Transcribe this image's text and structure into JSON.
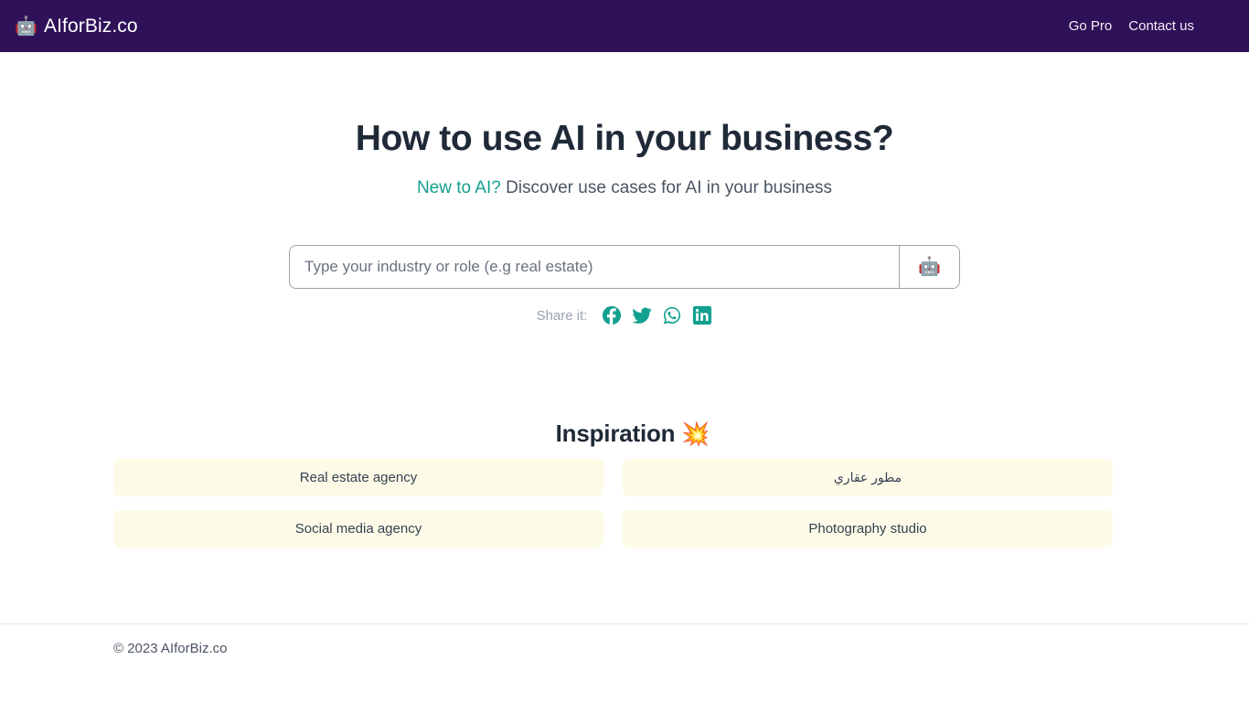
{
  "navbar": {
    "brand_icon": "robot-icon",
    "brand_icon_glyph": "🤖",
    "brand_name": "AIforBiz.co",
    "links": [
      {
        "label": "Go Pro"
      },
      {
        "label": "Contact us"
      }
    ]
  },
  "hero": {
    "title": "How to use AI in your business?",
    "subtitle_accent": "New to AI?",
    "subtitle_rest": " Discover use cases for AI in your business"
  },
  "search": {
    "placeholder": "Type your industry or role (e.g real estate)",
    "value": "",
    "submit_icon": "robot-icon",
    "submit_glyph": "🤖"
  },
  "share": {
    "label": "Share it:",
    "items": [
      {
        "name": "facebook-icon",
        "title": "Facebook"
      },
      {
        "name": "twitter-icon",
        "title": "Twitter"
      },
      {
        "name": "whatsapp-icon",
        "title": "WhatsApp"
      },
      {
        "name": "linkedin-icon",
        "title": "LinkedIn"
      }
    ]
  },
  "inspiration": {
    "heading": "Inspiration",
    "emoji": "💥",
    "cards": [
      {
        "label": "Real estate agency",
        "rtl": false
      },
      {
        "label": "مطور عقاري",
        "rtl": true
      },
      {
        "label": "Social media agency",
        "rtl": false
      },
      {
        "label": "Photography studio",
        "rtl": false
      }
    ]
  },
  "footer": {
    "copyright": "© 2023 AIforBiz.co"
  },
  "colors": {
    "navbar_bg": "#2f1159",
    "accent_teal": "#13a08f",
    "card_bg": "#fdfbe8",
    "title": "#1f2937"
  }
}
